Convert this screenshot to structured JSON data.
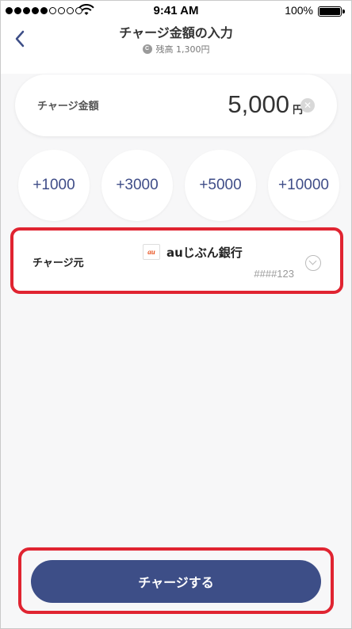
{
  "status_bar": {
    "time": "9:41 AM",
    "battery_percent": "100%",
    "signal_bars_filled": 5,
    "signal_bars_total": 9,
    "icons": [
      "signal-icon",
      "wifi-icon",
      "battery-icon"
    ]
  },
  "header": {
    "title": "チャージ金額の入力",
    "balance_icon_text": "C",
    "balance_text": "残高 1,300円",
    "back_icon": "chevron-left-icon"
  },
  "amount": {
    "label": "チャージ金額",
    "value": "5,000",
    "unit": "円",
    "clear_icon": "clear-icon"
  },
  "quick_add": [
    {
      "label": "+1000"
    },
    {
      "label": "+3000"
    },
    {
      "label": "+5000"
    },
    {
      "label": "+10000"
    }
  ],
  "source": {
    "label": "チャージ元",
    "bank_logo_text": "au",
    "bank_name": "auじぶん銀行",
    "account": "####123",
    "chevron_icon": "chevron-down-icon"
  },
  "charge_button": {
    "label": "チャージする"
  },
  "colors": {
    "accent": "#3d4e87",
    "highlight_border": "#e02431",
    "background": "#f7f7f8"
  }
}
